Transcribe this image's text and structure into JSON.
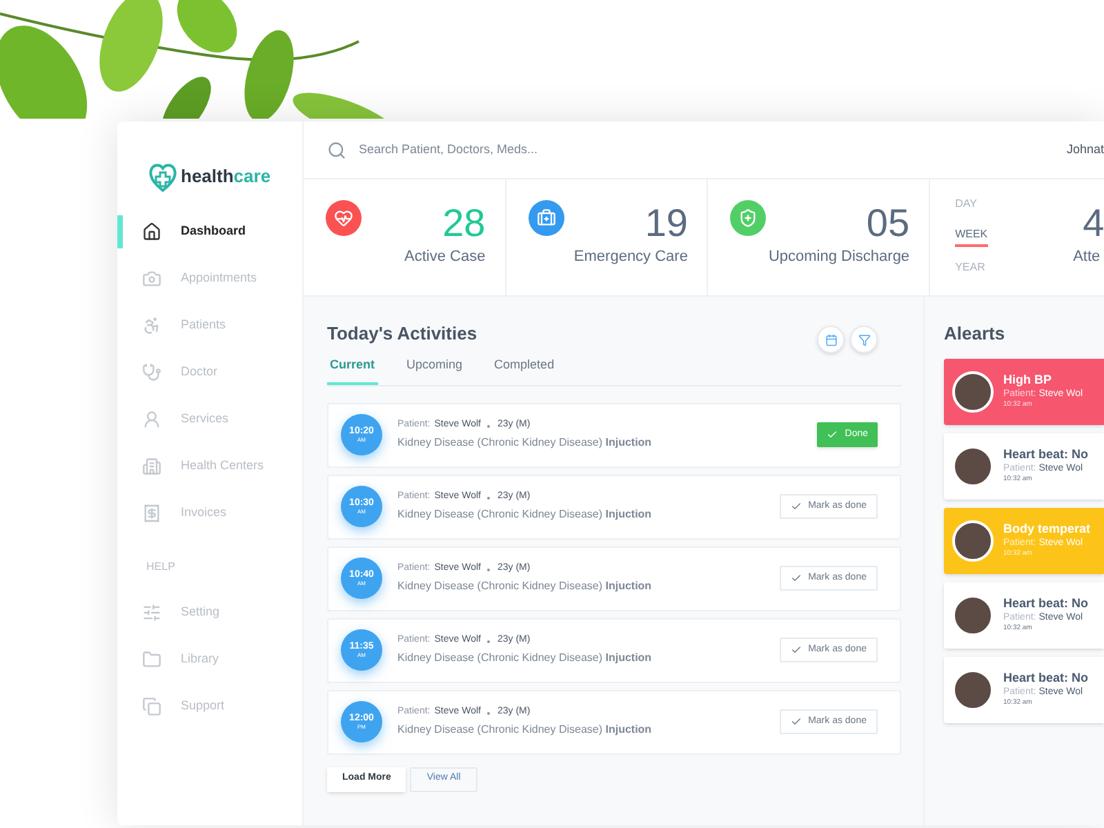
{
  "logo": {
    "part_1": "health",
    "part_2": "care"
  },
  "sidebar": {
    "items": [
      {
        "label": "Dashboard",
        "selected": true
      },
      {
        "label": "Appointments",
        "selected": false
      },
      {
        "label": "Patients",
        "selected": false
      },
      {
        "label": "Doctor",
        "selected": false
      },
      {
        "label": "Services",
        "selected": false
      },
      {
        "label": "Health Centers",
        "selected": false
      },
      {
        "label": "Invoices",
        "selected": false
      }
    ],
    "help_heading": "HELP",
    "help_items": [
      {
        "label": "Setting",
        "selected": false
      },
      {
        "label": "Library",
        "selected": false
      },
      {
        "label": "Support",
        "selected": false
      }
    ]
  },
  "search": {
    "placeholder": "Search Patient, Doctors, Meds..."
  },
  "user_name": "Johnat",
  "stats": [
    {
      "value": "28",
      "label": "Active Case",
      "color": "#fa5252",
      "highlighted": true
    },
    {
      "value": "19",
      "label": "Emergency Care",
      "color": "#339af0",
      "highlighted": false
    },
    {
      "value": "05",
      "label": "Upcoming Discharge",
      "color": "#51cf66",
      "highlighted": false
    }
  ],
  "periods": [
    {
      "label": "DAY",
      "selected": false
    },
    {
      "label": "WEEK",
      "selected": true
    },
    {
      "label": "YEAR",
      "selected": false
    }
  ],
  "attendance": {
    "value": "4",
    "label": "Atte"
  },
  "activities": {
    "title": "Today's Activities",
    "tabs": [
      {
        "label": "Current",
        "selected": true
      },
      {
        "label": "Upcoming",
        "selected": false
      },
      {
        "label": "Completed",
        "selected": false
      }
    ],
    "items": [
      {
        "time": "10:20",
        "meridiem": "AM",
        "patient_label": "Patient:",
        "patient": "Steve Wolf",
        "age": "23y (M)",
        "description": "Kidney Disease (Chronic Kidney Disease) **Injuction**",
        "action": "Done",
        "done": true
      },
      {
        "time": "10:30",
        "meridiem": "AM",
        "patient_label": "Patient:",
        "patient": "Steve Wolf",
        "age": "23y (M)",
        "description": "Kidney Disease (Chronic Kidney Disease) **Injuction**",
        "action": "Mark as done",
        "done": false
      },
      {
        "time": "10:40",
        "meridiem": "AM",
        "patient_label": "Patient:",
        "patient": "Steve Wolf",
        "age": "23y (M)",
        "description": "Kidney Disease (Chronic Kidney Disease) **Injuction**",
        "action": "Mark as done",
        "done": false
      },
      {
        "time": "11:35",
        "meridiem": "AM",
        "patient_label": "Patient:",
        "patient": "Steve Wolf",
        "age": "23y (M)",
        "description": "Kidney Disease (Chronic Kidney Disease) **Injuction**",
        "action": "Mark as done",
        "done": false
      },
      {
        "time": "12:00",
        "meridiem": "PM",
        "patient_label": "Patient:",
        "patient": "Steve Wolf",
        "age": "23y (M)",
        "description": "Kidney Disease (Chronic Kidney Disease) **Injuction**",
        "action": "Mark as done",
        "done": false
      }
    ],
    "buttons": [
      "Load More",
      "View All"
    ]
  },
  "alerts": {
    "title": "Alearts",
    "items": [
      {
        "kind": "critical",
        "title": "High BP",
        "patient_label": "Patient:",
        "patient": "Steve Wol",
        "time": "10:32 am"
      },
      {
        "kind": "normal",
        "title": "Heart beat: No",
        "patient_label": "Patient:",
        "patient": "Steve Wol",
        "time": "10:32 am"
      },
      {
        "kind": "warning",
        "title": "Body temperat",
        "patient_label": "Patient:",
        "patient": "Steve Wol",
        "time": "10:32 am"
      },
      {
        "kind": "normal",
        "title": "Heart beat: No",
        "patient_label": "Patient:",
        "patient": "Steve Wol",
        "time": "10:32 am"
      },
      {
        "kind": "normal",
        "title": "Heart beat: No",
        "patient_label": "Patient:",
        "patient": "Steve Wol",
        "time": "10:32 am"
      }
    ]
  }
}
